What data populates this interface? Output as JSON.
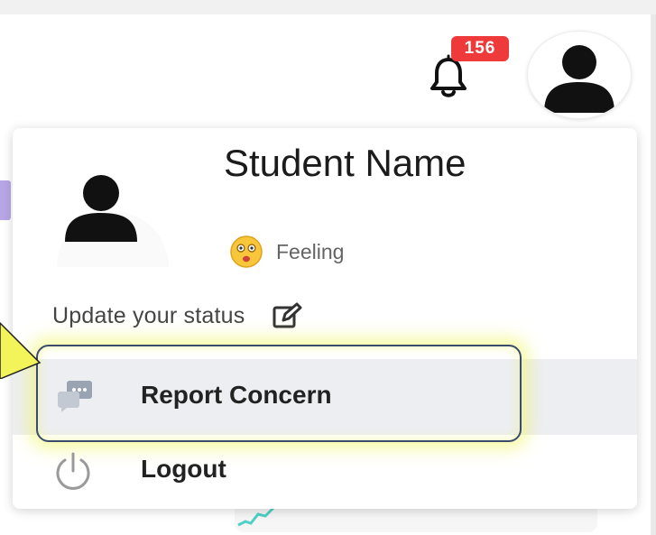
{
  "header": {
    "notification_count": "156",
    "bell_icon": "bell-icon",
    "avatar_icon": "user-avatar-icon"
  },
  "profile": {
    "name": "Student Name",
    "feeling_label": "Feeling",
    "feeling_icon": "smiley-face-icon"
  },
  "menu": {
    "update_status_label": "Update your status",
    "update_status_icon": "edit-icon",
    "report_label": "Report Concern",
    "report_icon": "chat-bubbles-icon",
    "logout_label": "Logout",
    "logout_icon": "power-icon"
  },
  "colors": {
    "badge": "#ee3a3a",
    "highlight_glow": "#eef55a",
    "highlight_border": "#3b4b6e",
    "selected_row_bg": "#edeef1"
  }
}
